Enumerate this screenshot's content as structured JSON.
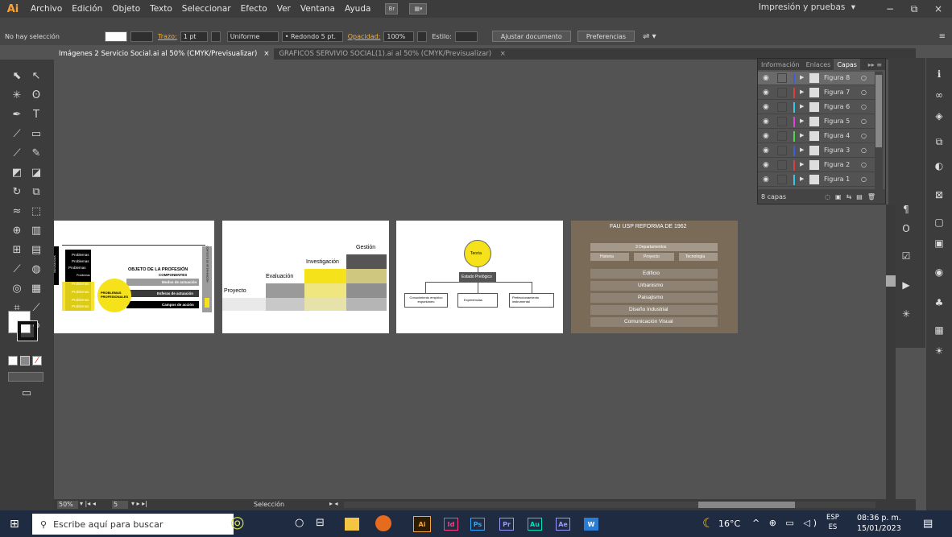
{
  "app": {
    "logo": "Ai",
    "workspace": "Impresión y pruebas",
    "workspace_caret": "▾"
  },
  "menu": [
    "Archivo",
    "Edición",
    "Objeto",
    "Texto",
    "Seleccionar",
    "Efecto",
    "Ver",
    "Ventana",
    "Ayuda"
  ],
  "menu_icons": {
    "bridge": "Br",
    "arrange": "▦▾"
  },
  "window_controls": {
    "minimize": "−",
    "restore": "⧉",
    "close": "×"
  },
  "control_bar": {
    "selection": "No hay selección",
    "stroke_label": "Trazo:",
    "stroke_value": "1 pt",
    "stroke_profile": "Uniforme",
    "brush": "• Redondo 5 pt.",
    "opacity_label": "Opacidad:",
    "opacity_value": "100%",
    "style_label": "Estilo:",
    "fit_button": "Ajustar documento",
    "prefs_button": "Preferencias"
  },
  "tabs": [
    {
      "label": "Imágenes 2 Servicio Social.ai al 50% (CMYK/Previsualizar)",
      "close": "×",
      "active": true
    },
    {
      "label": "GRAFICOS SERVIVIO SOCIAL(1).ai al 50% (CMYK/Previsualizar)",
      "close": "×",
      "active": false
    }
  ],
  "layers_panel": {
    "tabs": [
      "Información",
      "Enlaces",
      "Capas"
    ],
    "active_tab": "Capas",
    "layers": [
      {
        "name": "Figura 8",
        "color": "#3f5fd8",
        "selected": true
      },
      {
        "name": "Figura 7",
        "color": "#e23b3b",
        "selected": false
      },
      {
        "name": "Figura 6",
        "color": "#35c7e8",
        "selected": false
      },
      {
        "name": "Figura 5",
        "color": "#d845d8",
        "selected": false
      },
      {
        "name": "Figura 4",
        "color": "#4ad84a",
        "selected": false
      },
      {
        "name": "Figura 3",
        "color": "#3f5fd8",
        "selected": false
      },
      {
        "name": "Figura 2",
        "color": "#e23b3b",
        "selected": false
      },
      {
        "name": "Figura 1",
        "color": "#35c7e8",
        "selected": false
      }
    ],
    "count": "8 capas"
  },
  "artboard1": {
    "left_vertical": "NECESIDADES",
    "right_vertical": "CONTEXTO DE INTERVENCIÓN",
    "problems_list": [
      "Problemas",
      "Problemas",
      "Problemas",
      "Problemas",
      "Problemas",
      "Problemas",
      "Problemas",
      "Problemas"
    ],
    "title": "OBJETO DE LA PROFESIÓN",
    "subtitle": "COMPONENTES",
    "bars": [
      "Modos de actuación",
      "Esferas de actuación",
      "Campos de acción"
    ],
    "circle_label": "PROBLEMAS PROFESIONALES"
  },
  "artboard2": {
    "labels": [
      "Proyecto",
      "Evaluación",
      "Investigación",
      "Gestión"
    ]
  },
  "artboard3": {
    "top": "Teoría",
    "middle": "Estado Prelógico",
    "leaves": [
      "Conocimiento empírico espontáneo",
      "Experiencias",
      "Perfeccionamiento instrumental"
    ]
  },
  "artboard4": {
    "title": "FAU USP   REFORMA DE 1962",
    "header": "3 Departamentos",
    "departments": [
      "Historia",
      "Proyecto",
      "Tecnología"
    ],
    "items": [
      "Edificio",
      "Urbanismo",
      "Paisajismo",
      "Diseño Industrial",
      "Comunicación Visual"
    ]
  },
  "status": {
    "zoom": "50%",
    "page": "5",
    "tool": "Selección"
  },
  "taskbar": {
    "search_placeholder": "Escribe aquí para buscar",
    "apps": [
      "Ai",
      "Id",
      "Ps",
      "Pr",
      "Au",
      "Ae",
      "W"
    ],
    "temperature": "16°C",
    "lang_top": "ESP",
    "lang_bottom": "ES",
    "time": "08:36 p. m.",
    "date": "15/01/2023"
  }
}
